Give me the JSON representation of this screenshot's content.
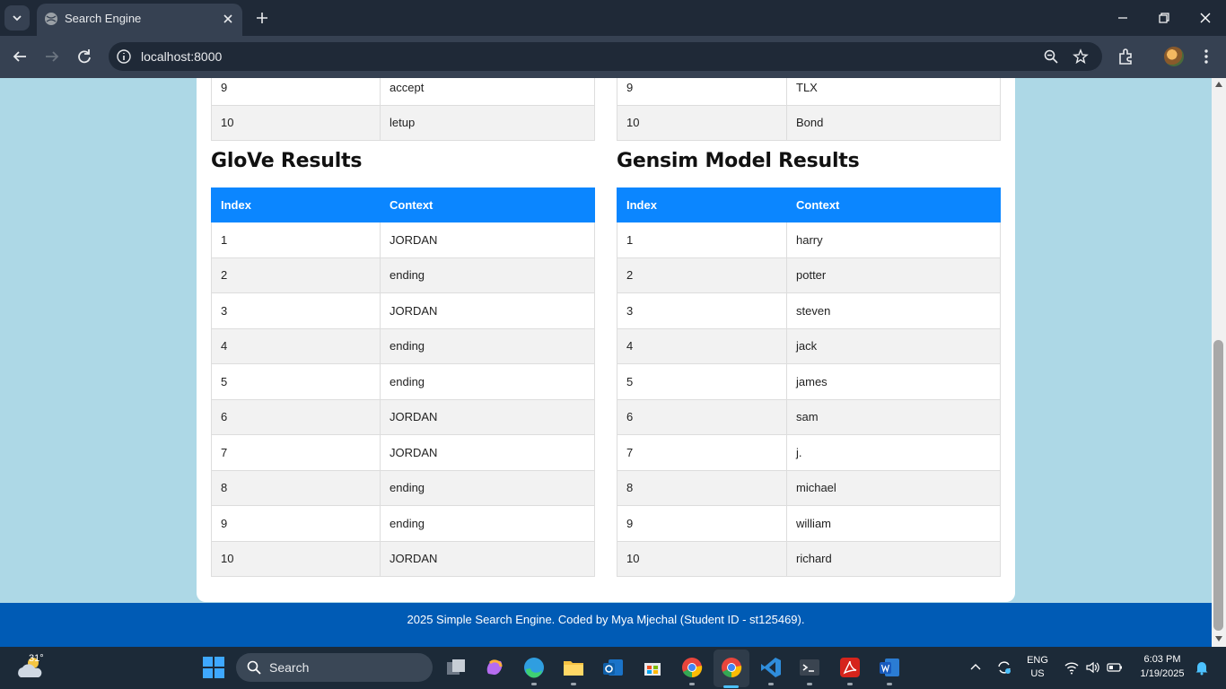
{
  "browser": {
    "tab_title": "Search Engine",
    "url": "localhost:8000"
  },
  "top_left_table": {
    "rows": [
      {
        "index": "9",
        "context": "accept"
      },
      {
        "index": "10",
        "context": "letup"
      }
    ]
  },
  "top_right_table": {
    "rows": [
      {
        "index": "9",
        "context": "TLX"
      },
      {
        "index": "10",
        "context": "Bond"
      }
    ]
  },
  "glove": {
    "title": "GloVe Results",
    "headers": {
      "index": "Index",
      "context": "Context"
    },
    "rows": [
      {
        "index": "1",
        "context": "JORDAN"
      },
      {
        "index": "2",
        "context": "ending"
      },
      {
        "index": "3",
        "context": "JORDAN"
      },
      {
        "index": "4",
        "context": "ending"
      },
      {
        "index": "5",
        "context": "ending"
      },
      {
        "index": "6",
        "context": "JORDAN"
      },
      {
        "index": "7",
        "context": "JORDAN"
      },
      {
        "index": "8",
        "context": "ending"
      },
      {
        "index": "9",
        "context": "ending"
      },
      {
        "index": "10",
        "context": "JORDAN"
      }
    ]
  },
  "gensim": {
    "title": "Gensim Model Results",
    "headers": {
      "index": "Index",
      "context": "Context"
    },
    "rows": [
      {
        "index": "1",
        "context": "harry"
      },
      {
        "index": "2",
        "context": "potter"
      },
      {
        "index": "3",
        "context": "steven"
      },
      {
        "index": "4",
        "context": "jack"
      },
      {
        "index": "5",
        "context": "james"
      },
      {
        "index": "6",
        "context": "sam"
      },
      {
        "index": "7",
        "context": "j."
      },
      {
        "index": "8",
        "context": "michael"
      },
      {
        "index": "9",
        "context": "william"
      },
      {
        "index": "10",
        "context": "richard"
      }
    ]
  },
  "footer": {
    "text": "2025 Simple Search Engine. Coded by Mya Mjechal (Student ID - st125469)."
  },
  "taskbar": {
    "weather_temp": "31°",
    "search_label": "Search",
    "lang_top": "ENG",
    "lang_bottom": "US",
    "time": "6:03 PM",
    "date": "1/19/2025"
  },
  "colors": {
    "page_bg": "#add8e6",
    "table_header": "#0b86ff",
    "footer": "#005bb5"
  }
}
